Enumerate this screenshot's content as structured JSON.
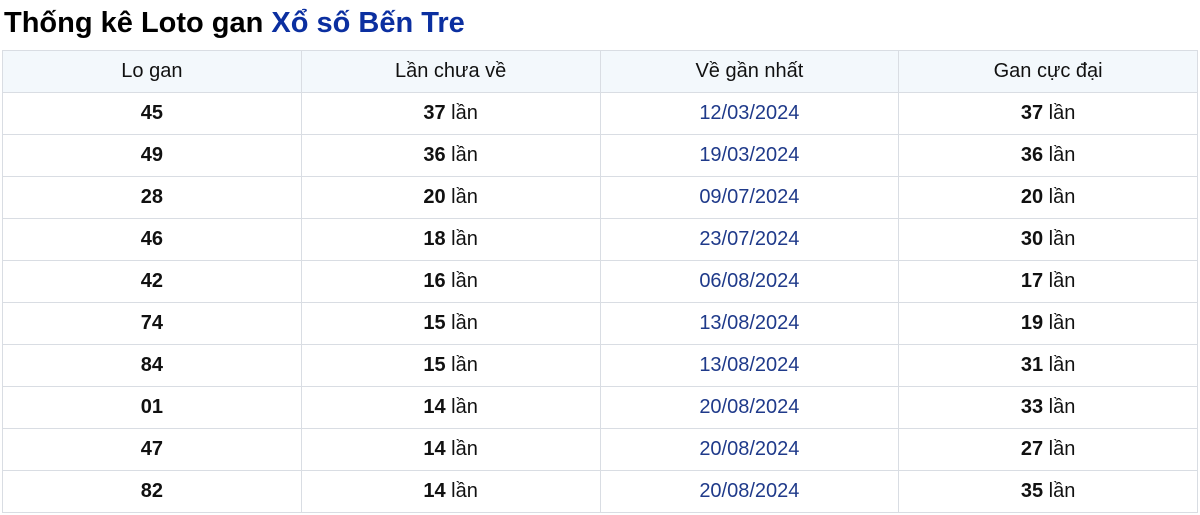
{
  "title": {
    "prefix": "Thống kê Loto gan",
    "brand_link": "Xổ số Bến Tre"
  },
  "table": {
    "headers": [
      "Lo gan",
      "Lần chưa về",
      "Về gần nhất",
      "Gan cực đại"
    ],
    "unit": "lần",
    "rows": [
      {
        "lo": "45",
        "missing": "37",
        "last": "12/03/2024",
        "max": "37"
      },
      {
        "lo": "49",
        "missing": "36",
        "last": "19/03/2024",
        "max": "36"
      },
      {
        "lo": "28",
        "missing": "20",
        "last": "09/07/2024",
        "max": "20"
      },
      {
        "lo": "46",
        "missing": "18",
        "last": "23/07/2024",
        "max": "30"
      },
      {
        "lo": "42",
        "missing": "16",
        "last": "06/08/2024",
        "max": "17"
      },
      {
        "lo": "74",
        "missing": "15",
        "last": "13/08/2024",
        "max": "19"
      },
      {
        "lo": "84",
        "missing": "15",
        "last": "13/08/2024",
        "max": "31"
      },
      {
        "lo": "01",
        "missing": "14",
        "last": "20/08/2024",
        "max": "33"
      },
      {
        "lo": "47",
        "missing": "14",
        "last": "20/08/2024",
        "max": "27"
      },
      {
        "lo": "82",
        "missing": "14",
        "last": "20/08/2024",
        "max": "35"
      }
    ]
  }
}
